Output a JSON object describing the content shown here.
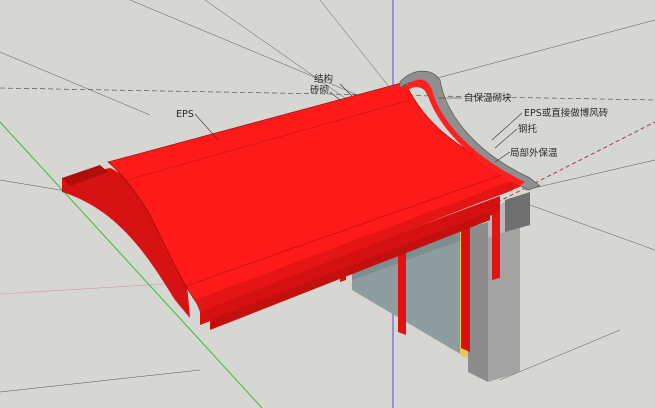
{
  "viewport": {
    "background": "#d6d6d2",
    "axes": {
      "blue": "#4a4ae0",
      "green": "#38c038",
      "red_dashed": "#9a4040"
    }
  },
  "model": {
    "roof_color": "#ff1a1a",
    "shadow_red": "#c40f0f",
    "wall_glass": "#8e9ea0",
    "masonry": "#9c9c9c",
    "insulation": "#e8c75a"
  },
  "callouts": {
    "structure": "结构",
    "masonry": "砖砌",
    "eps": "EPS",
    "self_insulation_block": "自保温砌块",
    "eps_gable_brick": "EPS或直接做博风砖",
    "steel_bracket": "钢托",
    "local_external_insulation": "局部外保温"
  }
}
